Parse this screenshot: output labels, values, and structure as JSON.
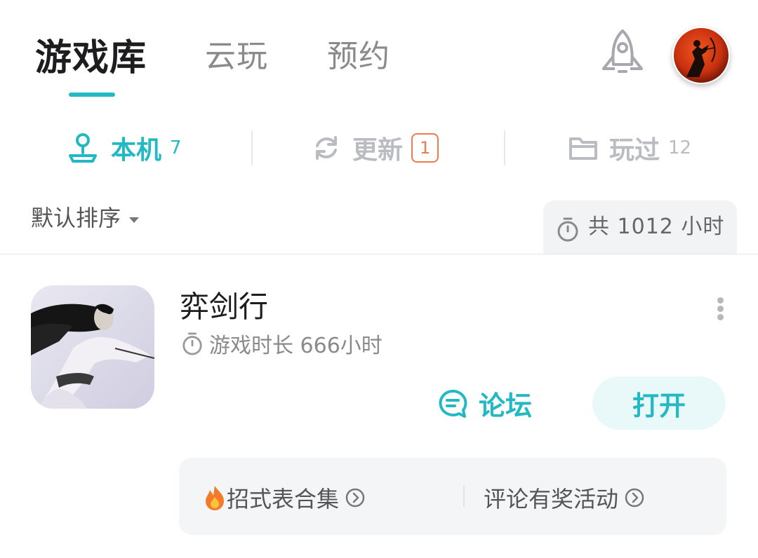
{
  "header": {
    "tabs": [
      {
        "label": "游戏库",
        "active": true
      },
      {
        "label": "云玩",
        "active": false
      },
      {
        "label": "预约",
        "active": false
      }
    ],
    "rocket_icon": "rocket-icon",
    "avatar_icon": "archer-avatar"
  },
  "filters": {
    "local": {
      "label": "本机",
      "count": "7",
      "icon": "download-station-icon"
    },
    "update": {
      "label": "更新",
      "badge": "1",
      "icon": "refresh-icon"
    },
    "played": {
      "label": "玩过",
      "count": "12",
      "icon": "folder-icon"
    }
  },
  "sort": {
    "label": "默认排序"
  },
  "total_time": {
    "label": "共 1012 小时"
  },
  "games": [
    {
      "title": "弈剑行",
      "playtime": "游戏时长 666小时",
      "forum_label": "论坛",
      "open_label": "打开",
      "extras": [
        {
          "label": "招式表合集",
          "prefix_icon": "fire-icon"
        },
        {
          "label": "评论有奖活动"
        }
      ]
    }
  ],
  "colors": {
    "accent": "#22b8c4",
    "badge": "#ef7a4f",
    "muted": "#b9bcc1"
  }
}
